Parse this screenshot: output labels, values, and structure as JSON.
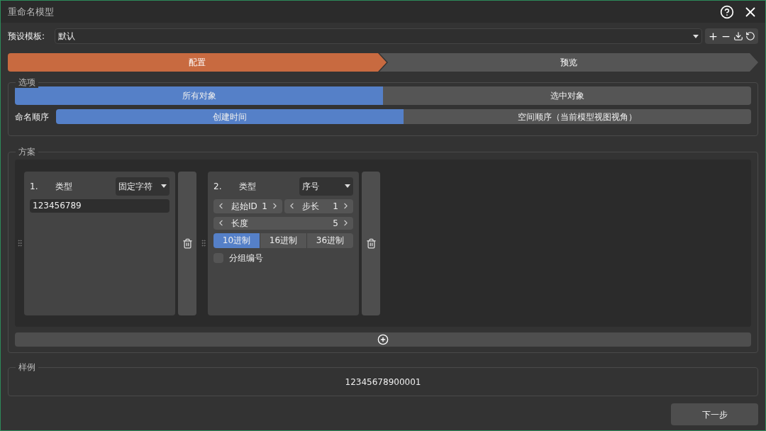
{
  "window": {
    "title": "重命名模型"
  },
  "preset": {
    "label": "预设模板:",
    "value": "默认"
  },
  "steps": [
    {
      "label": "配置",
      "selected": true
    },
    {
      "label": "预览",
      "selected": false
    }
  ],
  "options": {
    "title": "选项",
    "scope": [
      {
        "label": "所有对象",
        "selected": true
      },
      {
        "label": "选中对象",
        "selected": false
      }
    ],
    "order_label": "命名顺序",
    "order": [
      {
        "label": "创建时间",
        "selected": true
      },
      {
        "label": "空间顺序（当前模型视图视角）",
        "selected": false
      }
    ]
  },
  "scheme": {
    "title": "方案",
    "rules": [
      {
        "kind": "fixed",
        "index": "1.",
        "type_label": "类型",
        "type_value": "固定字符",
        "value": "123456789"
      },
      {
        "kind": "sequence",
        "index": "2.",
        "type_label": "类型",
        "type_value": "序号",
        "start_label": "起始ID",
        "start_value": "1",
        "step_label": "步长",
        "step_value": "1",
        "length_label": "长度",
        "length_value": "5",
        "bases": [
          {
            "label": "10进制",
            "selected": true
          },
          {
            "label": "16进制",
            "selected": false
          },
          {
            "label": "36进制",
            "selected": false
          }
        ],
        "group": {
          "label": "分组编号",
          "checked": false
        }
      }
    ]
  },
  "sample": {
    "title": "样例",
    "value": "12345678900001"
  },
  "next_button": "下一步"
}
